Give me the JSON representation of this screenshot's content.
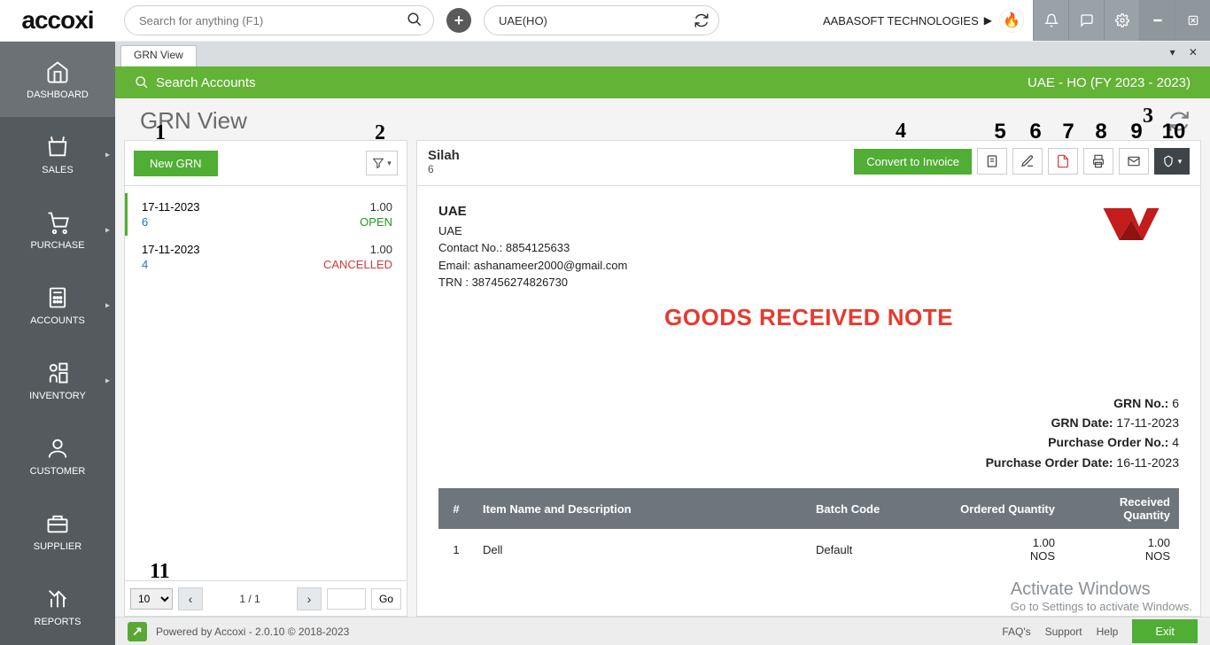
{
  "topbar": {
    "search_placeholder": "Search for anything (F1)",
    "branch": "UAE(HO)",
    "company": "AABASOFT TECHNOLOGIES"
  },
  "sidebar": {
    "items": [
      {
        "label": "DASHBOARD"
      },
      {
        "label": "SALES"
      },
      {
        "label": "PURCHASE"
      },
      {
        "label": "ACCOUNTS"
      },
      {
        "label": "INVENTORY"
      },
      {
        "label": "CUSTOMER"
      },
      {
        "label": "SUPPLIER"
      },
      {
        "label": "REPORTS"
      }
    ]
  },
  "tab": {
    "label": "GRN View"
  },
  "greenbar": {
    "search": "Search Accounts",
    "fy": "UAE - HO (FY 2023 - 2023)"
  },
  "page": {
    "title": "GRN View"
  },
  "annotations": {
    "a1": "1",
    "a2": "2",
    "a3": "3",
    "a4": "4",
    "a5": "5",
    "a6": "6",
    "a7": "7",
    "a8": "8",
    "a9": "9",
    "a10": "10",
    "a11": "11"
  },
  "left": {
    "new_label": "New GRN",
    "items": [
      {
        "date": "17-11-2023",
        "num": "6",
        "qty": "1.00",
        "status": "OPEN",
        "status_class": "open"
      },
      {
        "date": "17-11-2023",
        "num": "4",
        "qty": "1.00",
        "status": "CANCELLED",
        "status_class": "canc"
      }
    ],
    "pager": {
      "size": "10",
      "info": "1 / 1",
      "go": "Go"
    }
  },
  "detail": {
    "customer": "Silah",
    "grn_no_short": "6",
    "convert_label": "Convert to Invoice",
    "org": {
      "name": "UAE",
      "loc": "UAE",
      "contact_label": "Contact No.:",
      "contact": "8854125633",
      "email_label": "Email:",
      "email": "ashanameer2000@gmail.com",
      "trn_label": "TRN :",
      "trn": "387456274826730"
    },
    "doc_title": "GOODS RECEIVED NOTE",
    "meta": {
      "grn_no_label": "GRN No.:",
      "grn_no": "6",
      "grn_date_label": "GRN Date:",
      "grn_date": "17-11-2023",
      "po_no_label": "Purchase Order No.:",
      "po_no": "4",
      "po_date_label": "Purchase Order Date:",
      "po_date": "16-11-2023"
    },
    "table": {
      "h_no": "#",
      "h_name": "Item Name and Description",
      "h_batch": "Batch Code",
      "h_ord": "Ordered Quantity",
      "h_rec": "Received Quantity",
      "rows": [
        {
          "no": "1",
          "name": "Dell",
          "batch": "Default",
          "ord": "1.00",
          "ord_uom": "NOS",
          "rec": "1.00",
          "rec_uom": "NOS"
        }
      ]
    }
  },
  "footer": {
    "powered": "Powered by Accoxi - 2.0.10 © 2018-2023",
    "faqs": "FAQ's",
    "support": "Support",
    "help": "Help",
    "exit": "Exit"
  },
  "watermark": {
    "l1": "Activate Windows",
    "l2": "Go to Settings to activate Windows."
  }
}
